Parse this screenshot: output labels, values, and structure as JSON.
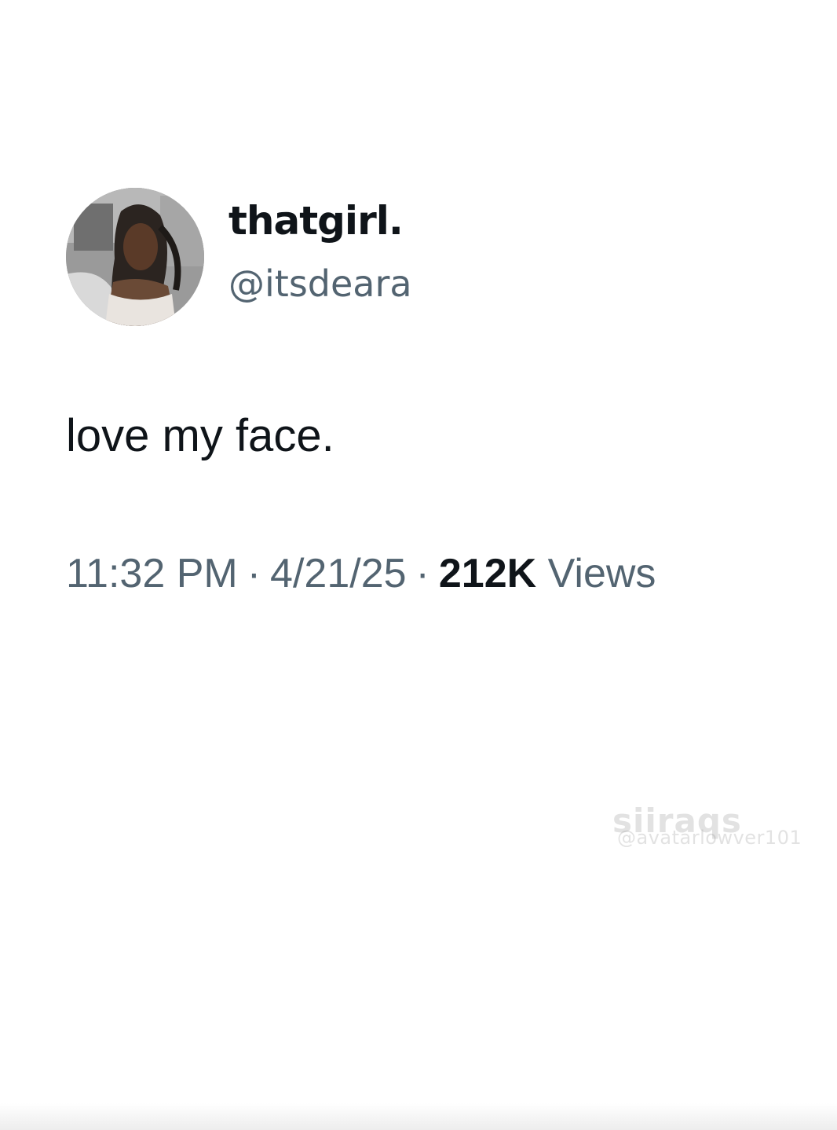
{
  "tweet": {
    "display_name": "thatgirl.",
    "handle": "@itsdeara",
    "text": "love my face.",
    "time": "11:32 PM",
    "date": "4/21/25",
    "separator": "·",
    "views_count": "212K",
    "views_label": "Views"
  },
  "watermark": {
    "main": "siiraqs",
    "sub": "@avatarlowver101"
  },
  "colors": {
    "text_primary": "#0f1419",
    "text_secondary": "#536471",
    "background": "#ffffff"
  }
}
